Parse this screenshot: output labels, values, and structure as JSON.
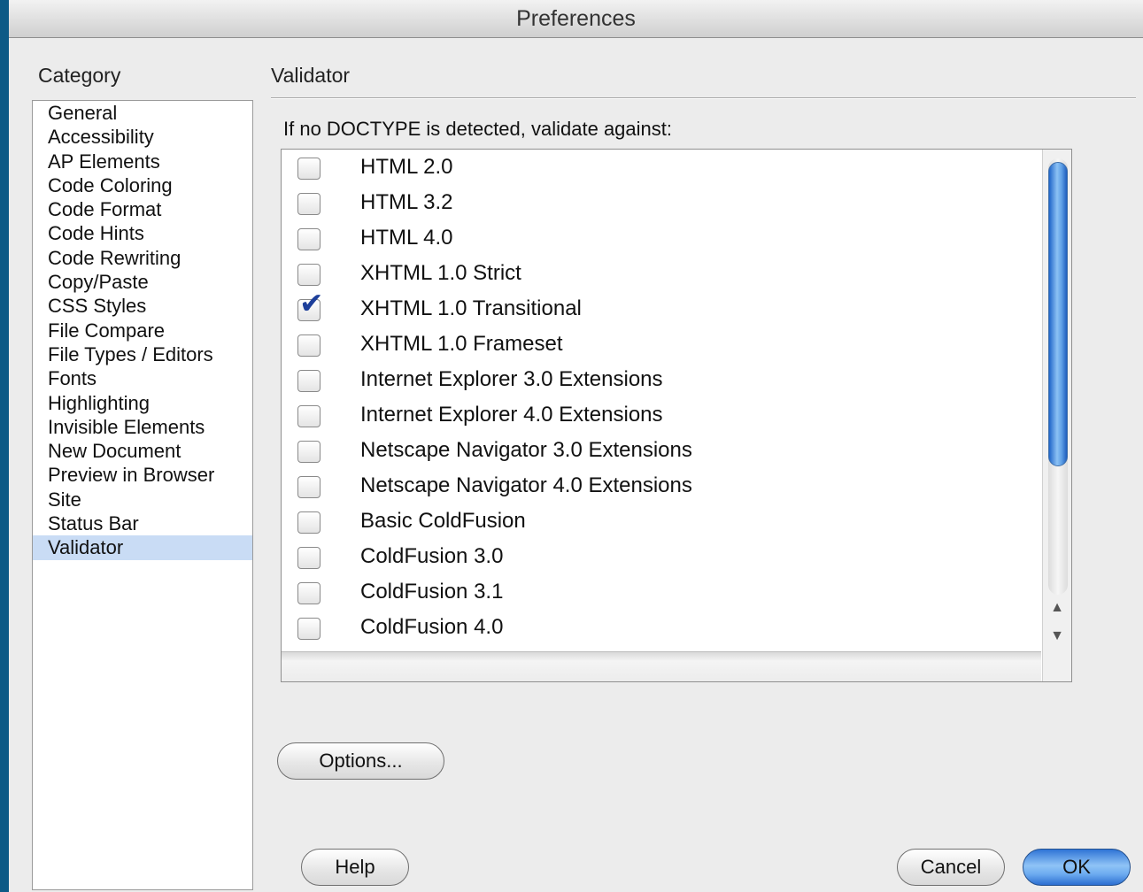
{
  "window": {
    "title": "Preferences"
  },
  "sidebar": {
    "heading": "Category",
    "items": [
      "General",
      "Accessibility",
      "AP Elements",
      "Code Coloring",
      "Code Format",
      "Code Hints",
      "Code Rewriting",
      "Copy/Paste",
      "CSS Styles",
      "File Compare",
      "File Types / Editors",
      "Fonts",
      "Highlighting",
      "Invisible Elements",
      "New Document",
      "Preview in Browser",
      "Site",
      "Status Bar",
      "Validator"
    ],
    "selected": "Validator"
  },
  "panel": {
    "title": "Validator",
    "prompt": "If no DOCTYPE is detected, validate against:",
    "doctypes": [
      {
        "label": "HTML 2.0",
        "checked": false
      },
      {
        "label": "HTML 3.2",
        "checked": false
      },
      {
        "label": "HTML 4.0",
        "checked": false
      },
      {
        "label": "XHTML 1.0 Strict",
        "checked": false
      },
      {
        "label": "XHTML 1.0 Transitional",
        "checked": true
      },
      {
        "label": "XHTML 1.0 Frameset",
        "checked": false
      },
      {
        "label": "Internet Explorer 3.0 Extensions",
        "checked": false
      },
      {
        "label": "Internet Explorer 4.0 Extensions",
        "checked": false
      },
      {
        "label": "Netscape Navigator 3.0 Extensions",
        "checked": false
      },
      {
        "label": "Netscape Navigator 4.0 Extensions",
        "checked": false
      },
      {
        "label": "Basic ColdFusion",
        "checked": false
      },
      {
        "label": "ColdFusion 3.0",
        "checked": false
      },
      {
        "label": "ColdFusion 3.1",
        "checked": false
      },
      {
        "label": "ColdFusion 4.0",
        "checked": false
      }
    ],
    "options_label": "Options..."
  },
  "footer": {
    "help_label": "Help",
    "cancel_label": "Cancel",
    "ok_label": "OK"
  },
  "colors": {
    "desktop": "#0d5a86",
    "selection": "#c9dcf5",
    "check": "#1d3f9a",
    "default_button": "#6cabf0"
  },
  "icons": {
    "checkbox_check": "checkmark-icon",
    "scroll_up": "up-arrow-icon",
    "scroll_down": "down-arrow-icon"
  }
}
